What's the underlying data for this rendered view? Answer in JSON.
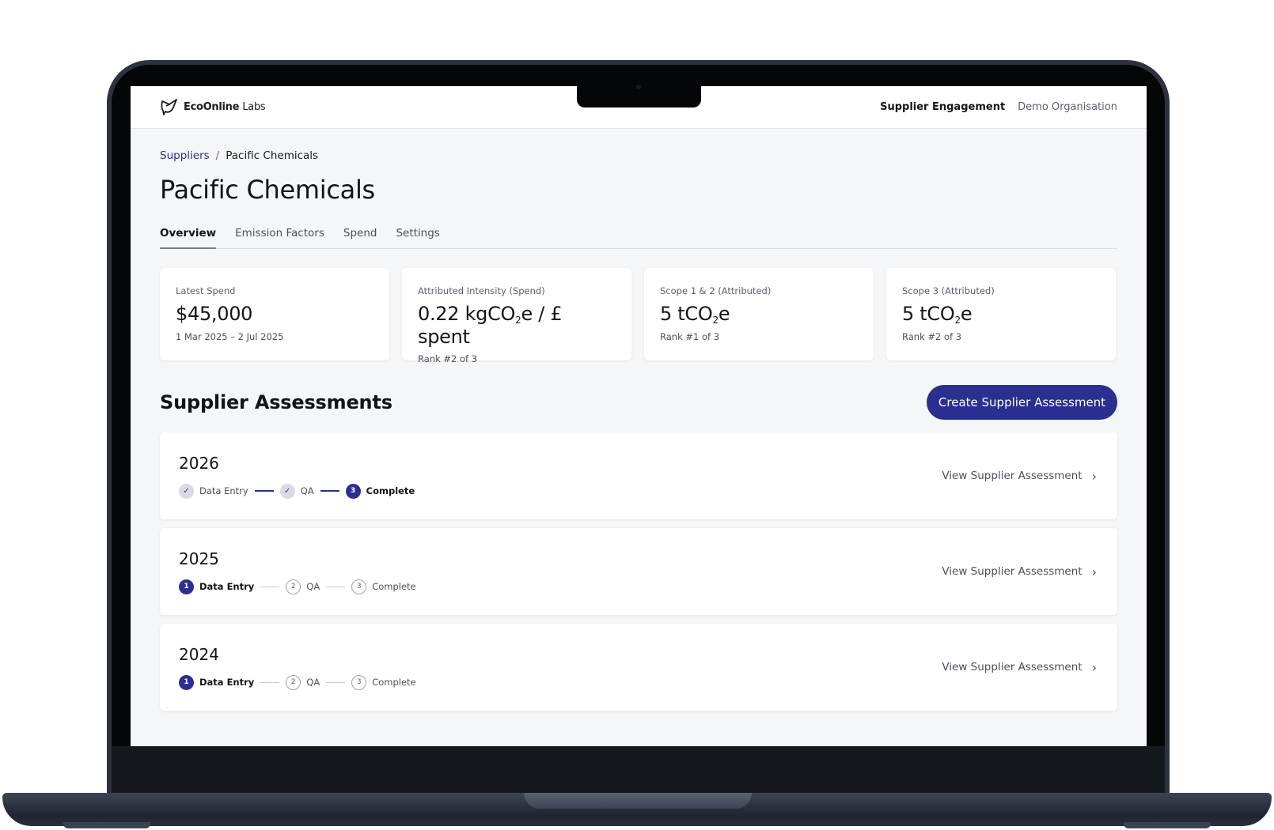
{
  "header": {
    "logo_bold": "EcoOnline",
    "logo_light": "Labs",
    "nav_active": "Supplier Engagement",
    "org": "Demo Organisation"
  },
  "breadcrumb": {
    "parent": "Suppliers",
    "separator": "/",
    "current": "Pacific Chemicals"
  },
  "page_title": "Pacific Chemicals",
  "tabs": [
    {
      "label": "Overview",
      "active": true
    },
    {
      "label": "Emission Factors",
      "active": false
    },
    {
      "label": "Spend",
      "active": false
    },
    {
      "label": "Settings",
      "active": false
    }
  ],
  "metrics": [
    {
      "label": "Latest Spend",
      "value_pre": "$45,000",
      "value_sub": "",
      "value_post": "",
      "subtext": "1 Mar 2025 – 2 Jul 2025"
    },
    {
      "label": "Attributed Intensity (Spend)",
      "value_pre": "0.22 kgCO",
      "value_sub": "2",
      "value_post": "e / £ spent",
      "subtext": "Rank #2 of 3"
    },
    {
      "label": "Scope 1 & 2 (Attributed)",
      "value_pre": "5 tCO",
      "value_sub": "2",
      "value_post": "e",
      "subtext": "Rank #1 of 3"
    },
    {
      "label": "Scope 3 (Attributed)",
      "value_pre": "5 tCO",
      "value_sub": "2",
      "value_post": "e",
      "subtext": "Rank #2 of 3"
    }
  ],
  "assessments_section": {
    "title": "Supplier Assessments",
    "create_button": "Create Supplier Assessment",
    "view_link": "View Supplier Assessment"
  },
  "assessments": [
    {
      "year": "2026",
      "steps": [
        {
          "label": "Data Entry",
          "marker": "✓",
          "state": "done"
        },
        {
          "label": "QA",
          "marker": "✓",
          "state": "done"
        },
        {
          "label": "Complete",
          "marker": "3",
          "state": "current"
        }
      ]
    },
    {
      "year": "2025",
      "steps": [
        {
          "label": "Data Entry",
          "marker": "1",
          "state": "current"
        },
        {
          "label": "QA",
          "marker": "2",
          "state": "pending"
        },
        {
          "label": "Complete",
          "marker": "3",
          "state": "pending"
        }
      ]
    },
    {
      "year": "2024",
      "steps": [
        {
          "label": "Data Entry",
          "marker": "1",
          "state": "current"
        },
        {
          "label": "QA",
          "marker": "2",
          "state": "pending"
        },
        {
          "label": "Complete",
          "marker": "3",
          "state": "pending"
        }
      ]
    }
  ],
  "colors": {
    "accent": "#2b2f8f",
    "link": "#2b3187",
    "background": "#f5f6f8"
  },
  "icons": {
    "logo": "bird-logo-icon",
    "chevron": "chevron-right-icon",
    "check": "check-icon"
  }
}
